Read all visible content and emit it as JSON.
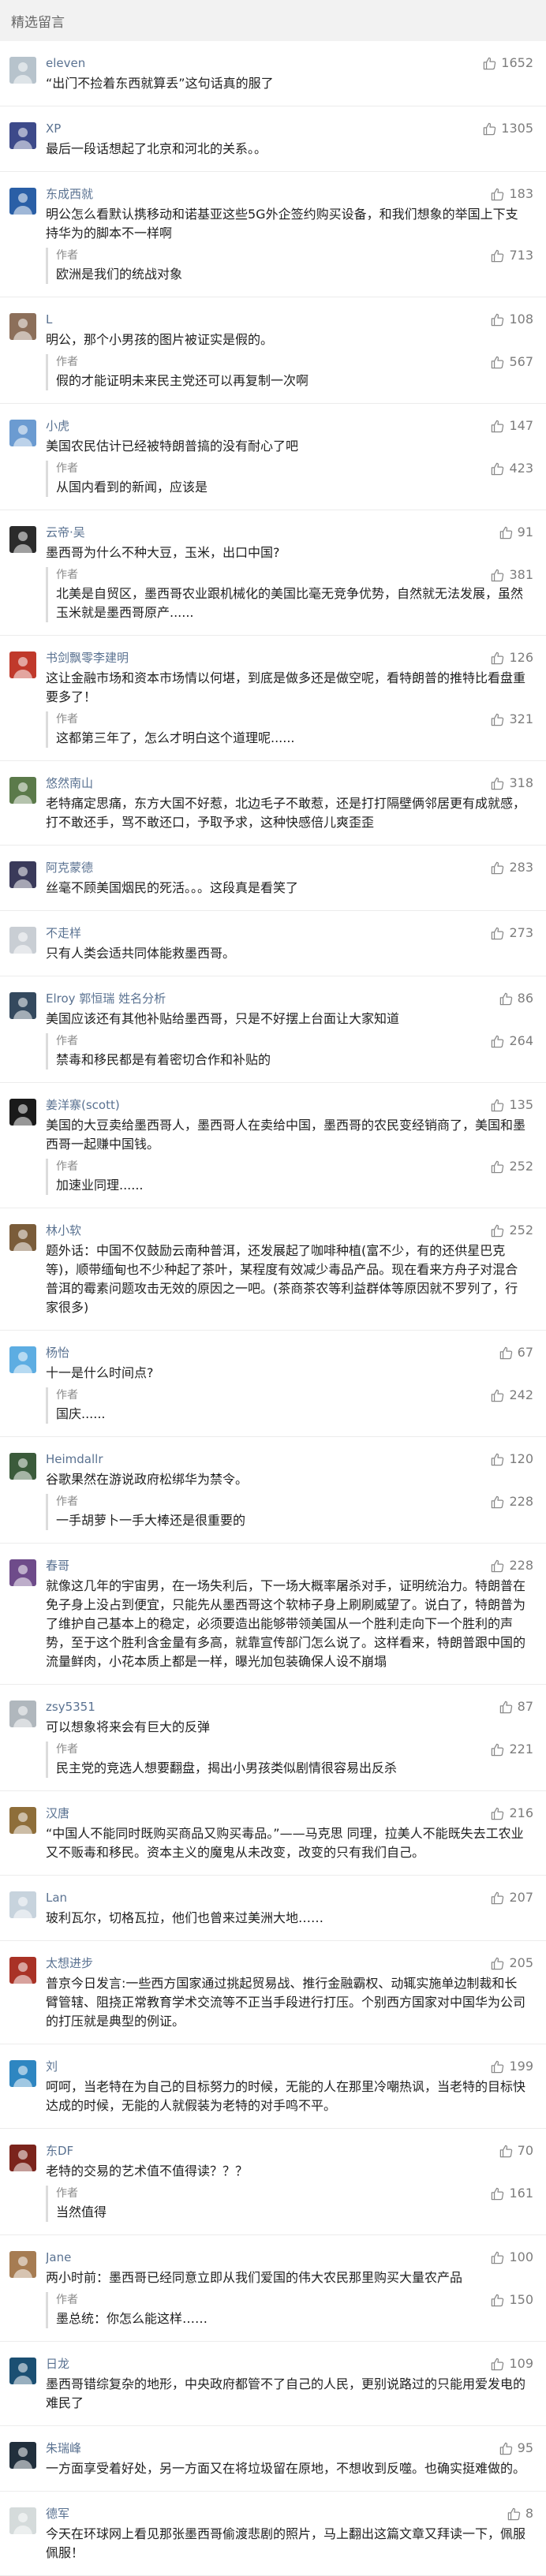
{
  "header": {
    "title": "精选留言"
  },
  "comments": [
    {
      "name": "eleven",
      "text": "“出门不捡着东西就算丢”这句话真的服了",
      "likes": "1652",
      "avatar": "#b7c3cc"
    },
    {
      "name": "XP",
      "text": "最后一段话想起了北京和河北的关系。。",
      "likes": "1305",
      "avatar": "#3d4a8a"
    },
    {
      "name": "东成西就",
      "text": "明公怎么看默认携移动和诺基亚这些5G外企签约购买设备，和我们想象的举国上下支持华为的脚本不一样啊",
      "likes": "183",
      "avatar": "#2a5fa6",
      "reply": {
        "author": "作者",
        "text": "欧洲是我们的统战对象",
        "likes": "713"
      }
    },
    {
      "name": "L",
      "text": "明公，那个小男孩的图片被证实是假的。",
      "likes": "108",
      "avatar": "#8c6f5a",
      "reply": {
        "author": "作者",
        "text": "假的才能证明未来民主党还可以再复制一次啊",
        "likes": "567"
      }
    },
    {
      "name": "小虎",
      "text": "美国农民估计已经被特朗普搞的没有耐心了吧",
      "likes": "147",
      "avatar": "#6b9bd1",
      "reply": {
        "author": "作者",
        "text": "从国内看到的新闻，应该是",
        "likes": "423"
      }
    },
    {
      "name": "云帝·吴",
      "text": "墨西哥为什么不种大豆，玉米，出口中国?",
      "likes": "91",
      "avatar": "#2b2b2b",
      "reply": {
        "author": "作者",
        "text": "北美是自贸区，墨西哥农业跟机械化的美国比毫无竞争优势，自然就无法发展，虽然玉米就是墨西哥原产......",
        "likes": "381"
      }
    },
    {
      "name": "书剑飘零李建明",
      "text": "这让金融市场和资本市场情以何堪，到底是做多还是做空呢，看特朗普的推特比看盘重要多了！",
      "likes": "126",
      "avatar": "#c0392b",
      "reply": {
        "author": "作者",
        "text": "这都第三年了，怎么才明白这个道理呢......",
        "likes": "321"
      }
    },
    {
      "name": "悠然南山",
      "text": "老特痛定思痛，东方大国不好惹，北边毛子不敢惹，还是打打隔壁俩邻居更有成就感，打不敢还手，骂不敢还口，予取予求，这种快感倍儿爽歪歪",
      "likes": "318",
      "avatar": "#5b7a4a"
    },
    {
      "name": "阿克蒙德",
      "text": "丝毫不顾美国烟民的死活。。。这段真是看笑了",
      "likes": "283",
      "avatar": "#3a3a5a"
    },
    {
      "name": "不走样",
      "text": "只有人类会适共同体能救墨西哥。",
      "likes": "273",
      "avatar": "#c9ced4"
    },
    {
      "name": "Elroy 郭恒瑞 姓名分析",
      "text": "美国应该还有其他补贴给墨西哥，只是不好摆上台面让大家知道",
      "likes": "86",
      "avatar": "#34495e",
      "reply": {
        "author": "作者",
        "text": "禁毒和移民都是有着密切合作和补贴的",
        "likes": "264"
      }
    },
    {
      "name": "姜洋寨(scott)",
      "text": "美国的大豆卖给墨西哥人，墨西哥人在卖给中国，墨西哥的农民变经销商了，美国和墨西哥一起赚中国钱。",
      "likes": "135",
      "avatar": "#1a1a1a",
      "reply": {
        "author": "作者",
        "text": "加速业同理......",
        "likes": "252"
      }
    },
    {
      "name": "林小软",
      "text": "题外话：中国不仅鼓励云南种普洱，还发展起了咖啡种植(富不少，有的还供星巴克等)，顺带缅甸也不少种起了茶叶，某程度有效减少毒品产品。现在看来方舟子对混合普洱的霉素问题攻击无效的原因之一吧。(茶商茶农等利益群体等原因就不罗列了，行家很多)",
      "likes": "252",
      "avatar": "#7a5c3a"
    },
    {
      "name": "杨怡",
      "text": "十一是什么时间点?",
      "likes": "67",
      "avatar": "#5dade2",
      "reply": {
        "author": "作者",
        "text": "国庆......",
        "likes": "242"
      }
    },
    {
      "name": "Heimdallr",
      "text": "谷歌果然在游说政府松绑华为禁令。",
      "likes": "120",
      "avatar": "#3b5b3b",
      "reply": {
        "author": "作者",
        "text": "一手胡萝卜一手大棒还是很重要的",
        "likes": "228"
      }
    },
    {
      "name": "春哥",
      "text": "就像这几年的宇宙男，在一场失利后，下一场大概率屠杀对手，证明统治力。特朗普在免子身上没占到便宜，只能先从墨西哥这个软柿子身上刷刷威望了。说白了，特朗普为了维护自己基本上的稳定，必须要造出能够带领美国从一个胜利走向下一个胜利的声势，至于这个胜利含金量有多高，就靠宣传部门怎么说了。这样看来，特朗普跟中国的流量鲜肉，小花本质上都是一样，曝光加包装确保人设不崩塌",
      "likes": "228",
      "avatar": "#6e4b8a"
    },
    {
      "name": "zsy5351",
      "text": "可以想象将来会有巨大的反弹",
      "likes": "87",
      "avatar": "#b0b7bd",
      "reply": {
        "author": "作者",
        "text": "民主党的竞选人想要翻盘，揭出小男孩类似剧情很容易出反杀",
        "likes": "221"
      }
    },
    {
      "name": "汉唐",
      "text": "“中国人不能同时既购买商品又购买毒品。”——马克思 同理，拉美人不能既失去工农业又不贩毒和移民。资本主义的魔鬼从未改变，改变的只有我们自己。",
      "likes": "216",
      "avatar": "#8e6e3a"
    },
    {
      "name": "Lan",
      "text": "玻利瓦尔，切格瓦拉，他们也曾来过美洲大地……",
      "likes": "207",
      "avatar": "#c7d3dd"
    },
    {
      "name": "太想进步",
      "text": "普京今日发言:一些西方国家通过挑起贸易战、推行金融霸权、动辄实施单边制裁和长臂管辖、阻挠正常教育学术交流等不正当手段进行打压。个别西方国家对中国华为公司的打压就是典型的例证。",
      "likes": "205",
      "avatar": "#a93226"
    },
    {
      "name": "刘",
      "text": "呵呵，当老特在为自己的目标努力的时候，无能的人在那里冷嘲热讽，当老特的目标快达成的时候，无能的人就假装为老特的对手鸣不平。",
      "likes": "199",
      "avatar": "#2e86c1"
    },
    {
      "name": "东DF",
      "text": "老特的交易的艺术值不值得读？？？",
      "likes": "70",
      "avatar": "#7b241c",
      "reply": {
        "author": "作者",
        "text": "当然值得",
        "likes": "161"
      }
    },
    {
      "name": "Jane",
      "text": "两小时前：墨西哥已经同意立即从我们爱国的伟大农民那里购买大量农产品",
      "likes": "100",
      "avatar": "#a67c52",
      "reply": {
        "author": "作者",
        "text": "墨总统：你怎么能这样……",
        "likes": "150"
      }
    },
    {
      "name": "日龙",
      "text": "墨西哥错综复杂的地形，中央政府都管不了自己的人民，更别说路过的只能用爱发电的难民了",
      "likes": "109",
      "avatar": "#1b4f72"
    },
    {
      "name": "朱瑞峰",
      "text": "一方面享受着好处，另一方面又在将垃圾留在原地，不想收到反噬。也确实挺难做的。",
      "likes": "95",
      "avatar": "#212f3c"
    },
    {
      "name": "德军",
      "text": "今天在环球网上看见那张墨西哥偷渡悲剧的照片，马上翻出这篇文章又拜读一下，佩服佩服！",
      "likes": "8",
      "avatar": "#d5dbdb"
    }
  ],
  "icons": {
    "like": "thumb-up-icon",
    "avatar": "user-avatar"
  },
  "colors": {
    "name": "#5a7291",
    "like": "#7d7d7d",
    "header_bg": "#f2f2f2",
    "reply_bar": "#dcdcdc"
  }
}
